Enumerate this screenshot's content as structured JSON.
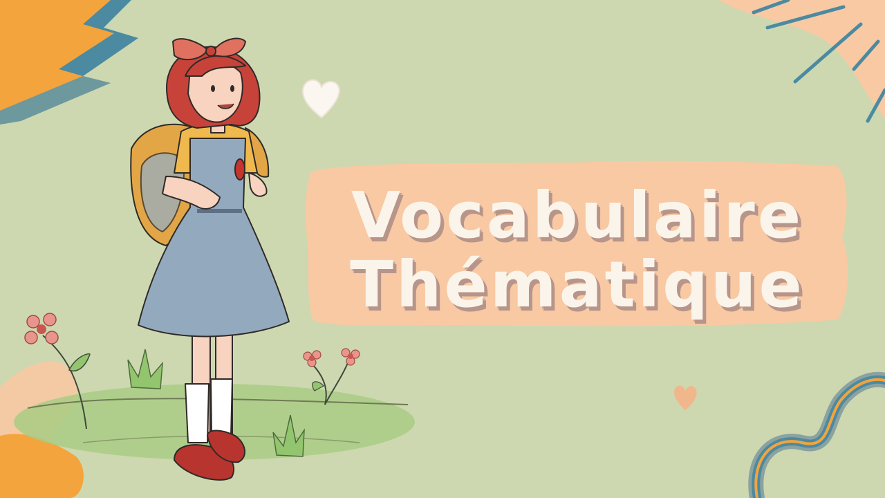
{
  "slide": {
    "title_line_1": "Vocabulaire",
    "title_line_2": "Thématique"
  },
  "colors": {
    "background": "#cdd8b0",
    "banner": "#f8c9a3",
    "title_text": "#fbf4ea",
    "title_shadow": "#b7958a",
    "accent_orange": "#f4a43c",
    "accent_blue": "#4b8aa0"
  },
  "icons": [
    "heart-icon",
    "flower-icon",
    "grass-icon",
    "sun-rays-icon",
    "wave-decoration"
  ]
}
